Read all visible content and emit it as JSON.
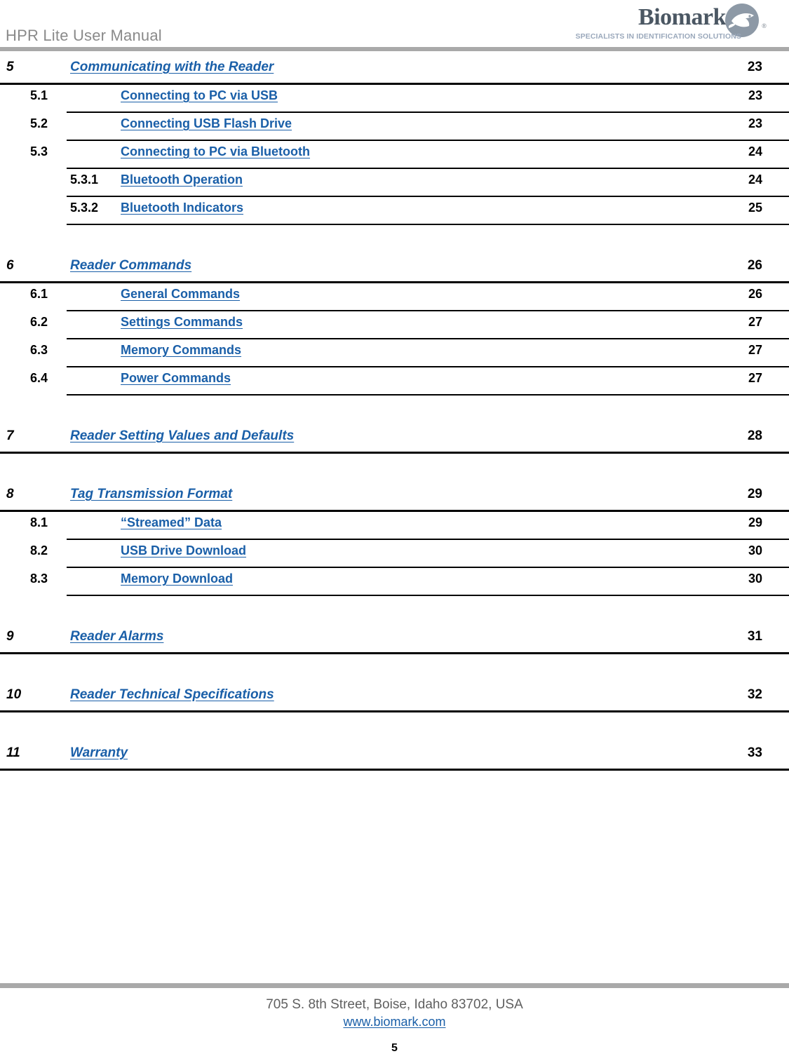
{
  "header": {
    "title": "HPR Lite User Manual",
    "logo": {
      "wordmark": "Biomark",
      "registered": "®",
      "tagline": "SPECIALISTS IN IDENTIFICATION SOLUTIONS",
      "mark_icon": "fish-in-circle-icon"
    },
    "bar_color": "#a9a9a9"
  },
  "toc": {
    "link_color": "#1a5fa8",
    "rows": [
      {
        "kind": "lvl1",
        "num": "5",
        "title": "Communicating with the Reader",
        "page": "23"
      },
      {
        "kind": "lvl2",
        "num": "5.1",
        "title": "Connecting to PC via USB",
        "page": "23"
      },
      {
        "kind": "lvl2",
        "num": "5.2",
        "title": "Connecting USB Flash Drive",
        "page": "23"
      },
      {
        "kind": "lvl2",
        "num": "5.3",
        "title": "Connecting to PC via Bluetooth",
        "page": "24"
      },
      {
        "kind": "lvl3",
        "num": "5.3.1",
        "title": "Bluetooth Operation",
        "page": "24"
      },
      {
        "kind": "lvl3",
        "num": "5.3.2",
        "title": "Bluetooth Indicators",
        "page": "25"
      },
      {
        "kind": "spacer"
      },
      {
        "kind": "lvl1",
        "num": "6",
        "title": "Reader Commands",
        "page": "26"
      },
      {
        "kind": "lvl2",
        "num": "6.1",
        "title": "General Commands",
        "page": "26"
      },
      {
        "kind": "lvl2",
        "num": "6.2",
        "title": "Settings Commands",
        "page": "27"
      },
      {
        "kind": "lvl2",
        "num": "6.3",
        "title": "Memory Commands",
        "page": "27"
      },
      {
        "kind": "lvl2",
        "num": "6.4",
        "title": "Power Commands",
        "page": "27"
      },
      {
        "kind": "spacer"
      },
      {
        "kind": "lvl1",
        "num": "7",
        "title": "Reader Setting Values and Defaults",
        "page": "28"
      },
      {
        "kind": "spacer"
      },
      {
        "kind": "lvl1",
        "num": "8",
        "title": "Tag Transmission Format",
        "page": "29"
      },
      {
        "kind": "lvl2",
        "num": "8.1",
        "title": "“Streamed” Data",
        "page": "29"
      },
      {
        "kind": "lvl2",
        "num": "8.2",
        "title": "USB Drive Download",
        "page": "30"
      },
      {
        "kind": "lvl2",
        "num": "8.3",
        "title": "Memory Download",
        "page": "30"
      },
      {
        "kind": "spacer"
      },
      {
        "kind": "lvl1",
        "num": "9",
        "title": "Reader Alarms",
        "page": "31"
      },
      {
        "kind": "spacer"
      },
      {
        "kind": "lvl1",
        "num": "10",
        "title": "Reader Technical Specifications",
        "page": "32"
      },
      {
        "kind": "spacer"
      },
      {
        "kind": "lvl1",
        "num": "11",
        "title": "Warranty",
        "page": "33"
      }
    ]
  },
  "footer": {
    "address": "705 S. 8th Street, Boise, Idaho 83702, USA",
    "url": "www.biomark.com",
    "page_number": "5",
    "bar_color": "#a9a9a9"
  }
}
